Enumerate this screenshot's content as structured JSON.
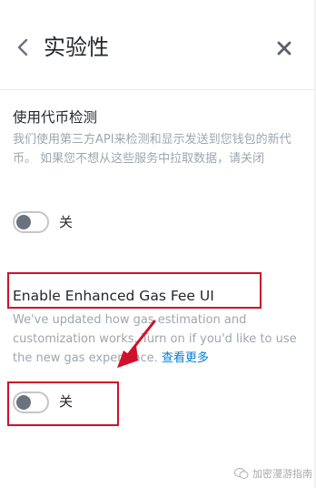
{
  "header": {
    "title": "实验性"
  },
  "token_detection": {
    "title": "使用代币检测",
    "description": "我们使用第三方API来检测和显示发送到您钱包的新代币。 如果您不想从这些服务中拉取数据，请关闭",
    "toggle_state": "off",
    "toggle_label": "关"
  },
  "enhanced_gas": {
    "title": "Enable Enhanced Gas Fee UI",
    "description": "We've updated how gas estimation and customization works. Turn on if you'd like to use the new gas experience.",
    "link_text": "查看更多",
    "toggle_state": "off",
    "toggle_label": "关"
  },
  "annotation": {
    "color": "#d0112b"
  },
  "watermark": {
    "text": "加密漫游指南"
  },
  "colors": {
    "link": "#037dd6",
    "text_primary": "#24272a",
    "text_secondary": "#9fa6ae"
  }
}
